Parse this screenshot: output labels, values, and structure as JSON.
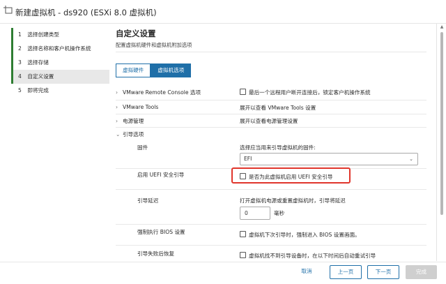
{
  "window": {
    "title": "新建虚拟机 - ds920 (ESXi 8.0 虚拟机)",
    "icon": "new-vm-icon"
  },
  "steps": [
    {
      "num": "1",
      "label": "选择创建类型",
      "state": "done"
    },
    {
      "num": "2",
      "label": "选择名称和客户机操作系统",
      "state": "done"
    },
    {
      "num": "3",
      "label": "选择存储",
      "state": "done"
    },
    {
      "num": "4",
      "label": "自定义设置",
      "state": "active"
    },
    {
      "num": "5",
      "label": "即将完成",
      "state": "pending"
    }
  ],
  "main": {
    "title": "自定义设置",
    "subtitle": "配置虚拟机硬件和虚拟机附加选项",
    "tabs": [
      {
        "label": "虚拟硬件",
        "selected": false
      },
      {
        "label": "虚拟机选项",
        "selected": true
      }
    ]
  },
  "options": {
    "vmrc": {
      "chevron": "›",
      "label": "VMware Remote Console 选项",
      "value": "最后一个远程用户断开连接后，锁定客户机操作系统",
      "checked": false
    },
    "tools": {
      "chevron": "›",
      "label": "VMware Tools",
      "value": "展开以查看 VMware Tools 设置"
    },
    "power": {
      "chevron": "›",
      "label": "电源管理",
      "value": "展开以查看电源管理设置"
    },
    "boot": {
      "chevron": "⌄",
      "label": "引导选项",
      "firmware": {
        "label": "固件",
        "hint": "选择应当用来引导虚拟机的固件:",
        "selected": "EFI",
        "arrow": "⌄"
      },
      "secure_boot": {
        "label": "启用 UEFI 安全引导",
        "value": "是否为此虚拟机启用 UEFI 安全引导",
        "checked": false
      },
      "boot_delay": {
        "label": "引导延迟",
        "hint": "打开虚拟机电源或重置虚拟机时，引导将延迟",
        "value": "0",
        "unit": "毫秒"
      },
      "force_bios": {
        "label": "强制执行 BIOS 设置",
        "value": "虚拟机下次引导时，强制进入 BIOS 设置画面。",
        "checked": false
      },
      "failed_recovery": {
        "label": "引导失败后恢复",
        "value": "虚拟机找不到引导设备时，在以下时间后自动重试引导",
        "checked": false
      }
    }
  },
  "footer": {
    "cancel": "取消",
    "prev": "上一页",
    "next": "下一页",
    "finish": "完成"
  },
  "colors": {
    "accent": "#1f6fa8",
    "step_done": "#2e7d32",
    "highlight": "#e0352b"
  }
}
